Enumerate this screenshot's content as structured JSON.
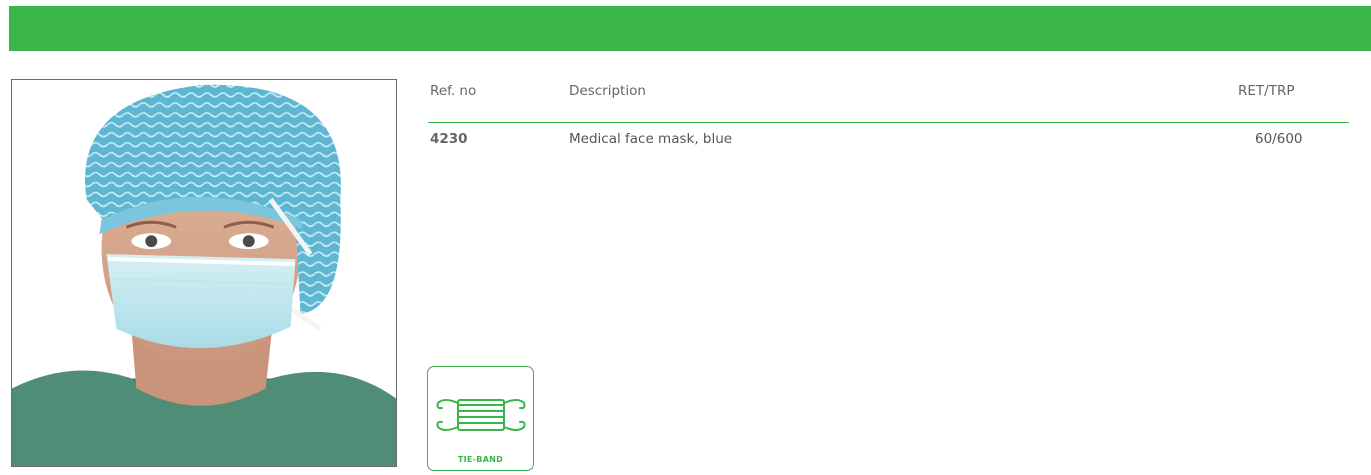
{
  "table": {
    "headers": {
      "ref": "Ref. no",
      "description": "Description",
      "ret_trp": "RET/TRP"
    },
    "rows": [
      {
        "ref": "4230",
        "description": "Medical face mask, blue",
        "ret_trp": "60/600"
      }
    ]
  },
  "badge": {
    "label": "TIE-BAND",
    "icon": "tie-band-mask-icon"
  },
  "photo": {
    "subject": "product-photo"
  },
  "colors": {
    "brand_green": "#39b54a",
    "text": "#555555"
  }
}
